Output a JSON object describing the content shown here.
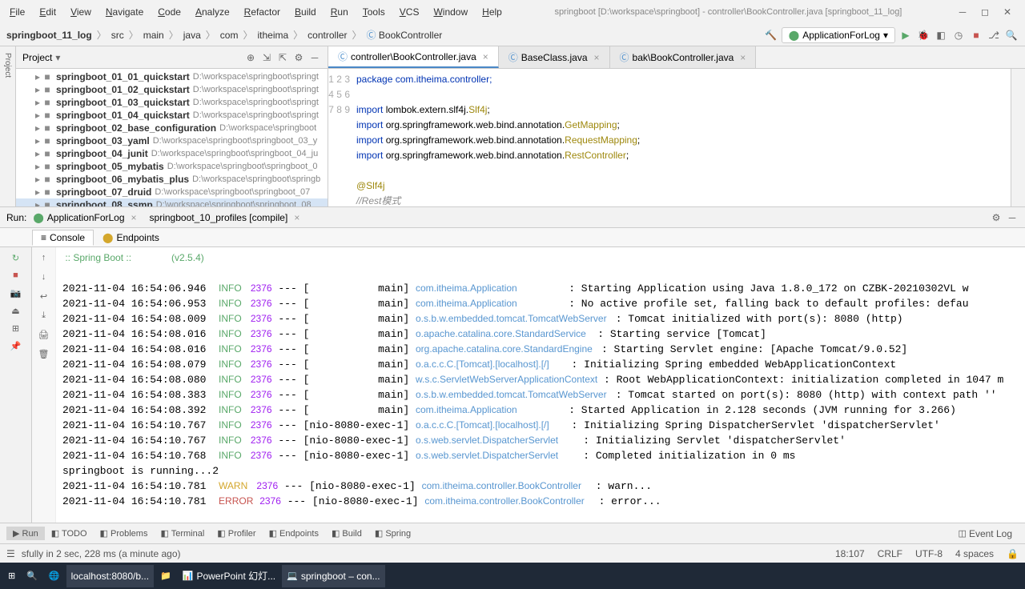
{
  "window": {
    "title": "springboot [D:\\workspace\\springboot] - controller\\BookController.java [springboot_11_log]"
  },
  "menu": [
    "File",
    "Edit",
    "View",
    "Navigate",
    "Code",
    "Analyze",
    "Refactor",
    "Build",
    "Run",
    "Tools",
    "VCS",
    "Window",
    "Help"
  ],
  "breadcrumb": [
    "springboot_11_log",
    "src",
    "main",
    "java",
    "com",
    "itheima",
    "controller",
    "BookController"
  ],
  "run_config": "ApplicationForLog",
  "project_header": "Project",
  "tree": [
    {
      "name": "springboot_01_01_quickstart",
      "path": "D:\\workspace\\springboot\\springt"
    },
    {
      "name": "springboot_01_02_quickstart",
      "path": "D:\\workspace\\springboot\\springt"
    },
    {
      "name": "springboot_01_03_quickstart",
      "path": "D:\\workspace\\springboot\\springt"
    },
    {
      "name": "springboot_01_04_quickstart",
      "path": "D:\\workspace\\springboot\\springt"
    },
    {
      "name": "springboot_02_base_configuration",
      "path": "D:\\workspace\\springboot"
    },
    {
      "name": "springboot_03_yaml",
      "path": "D:\\workspace\\springboot\\springboot_03_y"
    },
    {
      "name": "springboot_04_junit",
      "path": "D:\\workspace\\springboot\\springboot_04_ju"
    },
    {
      "name": "springboot_05_mybatis",
      "path": "D:\\workspace\\springboot\\springboot_0"
    },
    {
      "name": "springboot_06_mybatis_plus",
      "path": "D:\\workspace\\springboot\\springb"
    },
    {
      "name": "springboot_07_druid",
      "path": "D:\\workspace\\springboot\\springboot_07"
    },
    {
      "name": "springboot_08_ssmp",
      "path": "D:\\workspace\\springboot\\springboot_08"
    }
  ],
  "editor_tabs": [
    {
      "label": "controller\\BookController.java",
      "active": true
    },
    {
      "label": "BaseClass.java",
      "active": false
    },
    {
      "label": "bak\\BookController.java",
      "active": false
    }
  ],
  "code_lines": [
    "1",
    "2",
    "3",
    "4",
    "5",
    "6",
    "7",
    "8",
    "9"
  ],
  "code": {
    "l1": "package com.itheima.controller;",
    "l3_pre": "import ",
    "l3_mid": "lombok.extern.slf4j.",
    "l3_cls": "Slf4j",
    "l3_end": ";",
    "l4_pre": "import ",
    "l4_mid": "org.springframework.web.bind.annotation.",
    "l4_cls": "GetMapping",
    "l4_end": ";",
    "l5_pre": "import ",
    "l5_mid": "org.springframework.web.bind.annotation.",
    "l5_cls": "RequestMapping",
    "l5_end": ";",
    "l6_pre": "import ",
    "l6_mid": "org.springframework.web.bind.annotation.",
    "l6_cls": "RestController",
    "l6_end": ";",
    "l8": "@Slf4j",
    "l9": "//Rest模式"
  },
  "run": {
    "label": "Run:",
    "tab1": "ApplicationForLog",
    "tab2": "springboot_10_profiles [compile]",
    "subtab1": "Console",
    "subtab2": "Endpoints"
  },
  "console": {
    "banner": " :: Spring Boot ::               (v2.5.4)",
    "lines": [
      {
        "ts": "2021-11-04 16:54:06.946",
        "lvl": "INFO",
        "pid": "2376",
        "th": "[           main]",
        "cls": "com.itheima.Application                 ",
        "msg": ": Starting Application using Java 1.8.0_172 on CZBK-20210302VL w"
      },
      {
        "ts": "2021-11-04 16:54:06.953",
        "lvl": "INFO",
        "pid": "2376",
        "th": "[           main]",
        "cls": "com.itheima.Application                 ",
        "msg": ": No active profile set, falling back to default profiles: defau"
      },
      {
        "ts": "2021-11-04 16:54:08.009",
        "lvl": "INFO",
        "pid": "2376",
        "th": "[           main]",
        "cls": "o.s.b.w.embedded.tomcat.TomcatWebServer ",
        "msg": ": Tomcat initialized with port(s): 8080 (http)"
      },
      {
        "ts": "2021-11-04 16:54:08.016",
        "lvl": "INFO",
        "pid": "2376",
        "th": "[           main]",
        "cls": "o.apache.catalina.core.StandardService  ",
        "msg": ": Starting service [Tomcat]"
      },
      {
        "ts": "2021-11-04 16:54:08.016",
        "lvl": "INFO",
        "pid": "2376",
        "th": "[           main]",
        "cls": "org.apache.catalina.core.StandardEngine ",
        "msg": ": Starting Servlet engine: [Apache Tomcat/9.0.52]"
      },
      {
        "ts": "2021-11-04 16:54:08.079",
        "lvl": "INFO",
        "pid": "2376",
        "th": "[           main]",
        "cls": "o.a.c.c.C.[Tomcat].[localhost].[/]      ",
        "msg": ": Initializing Spring embedded WebApplicationContext"
      },
      {
        "ts": "2021-11-04 16:54:08.080",
        "lvl": "INFO",
        "pid": "2376",
        "th": "[           main]",
        "cls": "w.s.c.ServletWebServerApplicationContext",
        "msg": ": Root WebApplicationContext: initialization completed in 1047 m"
      },
      {
        "ts": "2021-11-04 16:54:08.383",
        "lvl": "INFO",
        "pid": "2376",
        "th": "[           main]",
        "cls": "o.s.b.w.embedded.tomcat.TomcatWebServer ",
        "msg": ": Tomcat started on port(s): 8080 (http) with context path ''"
      },
      {
        "ts": "2021-11-04 16:54:08.392",
        "lvl": "INFO",
        "pid": "2376",
        "th": "[           main]",
        "cls": "com.itheima.Application                 ",
        "msg": ": Started Application in 2.128 seconds (JVM running for 3.266)"
      },
      {
        "ts": "2021-11-04 16:54:10.767",
        "lvl": "INFO",
        "pid": "2376",
        "th": "[nio-8080-exec-1]",
        "cls": "o.a.c.c.C.[Tomcat].[localhost].[/]      ",
        "msg": ": Initializing Spring DispatcherServlet 'dispatcherServlet'"
      },
      {
        "ts": "2021-11-04 16:54:10.767",
        "lvl": "INFO",
        "pid": "2376",
        "th": "[nio-8080-exec-1]",
        "cls": "o.s.web.servlet.DispatcherServlet       ",
        "msg": ": Initializing Servlet 'dispatcherServlet'"
      },
      {
        "ts": "2021-11-04 16:54:10.768",
        "lvl": "INFO",
        "pid": "2376",
        "th": "[nio-8080-exec-1]",
        "cls": "o.s.web.servlet.DispatcherServlet       ",
        "msg": ": Completed initialization in 0 ms"
      }
    ],
    "plain": "springboot is running...2",
    "warn": {
      "ts": "2021-11-04 16:54:10.781",
      "lvl": "WARN",
      "pid": "2376",
      "th": "[nio-8080-exec-1]",
      "cls": "com.itheima.controller.BookController   ",
      "msg": ": warn..."
    },
    "error": {
      "ts": "2021-11-04 16:54:10.781",
      "lvl": "ERROR",
      "pid": "2376",
      "th": "[nio-8080-exec-1]",
      "cls": "com.itheima.controller.BookController   ",
      "msg": ": error..."
    }
  },
  "bottom_tabs": [
    "Run",
    "TODO",
    "Problems",
    "Terminal",
    "Profiler",
    "Endpoints",
    "Build",
    "Spring"
  ],
  "event_log": "Event Log",
  "status": {
    "msg": "sfully in 2 sec, 228 ms (a minute ago)",
    "pos": "18:107",
    "crlf": "CRLF",
    "enc": "UTF-8",
    "indent": "4 spaces"
  },
  "taskbar": [
    {
      "label": "localhost:8080/b..."
    },
    {
      "label": "PowerPoint 幻灯..."
    },
    {
      "label": "springboot – con..."
    }
  ]
}
